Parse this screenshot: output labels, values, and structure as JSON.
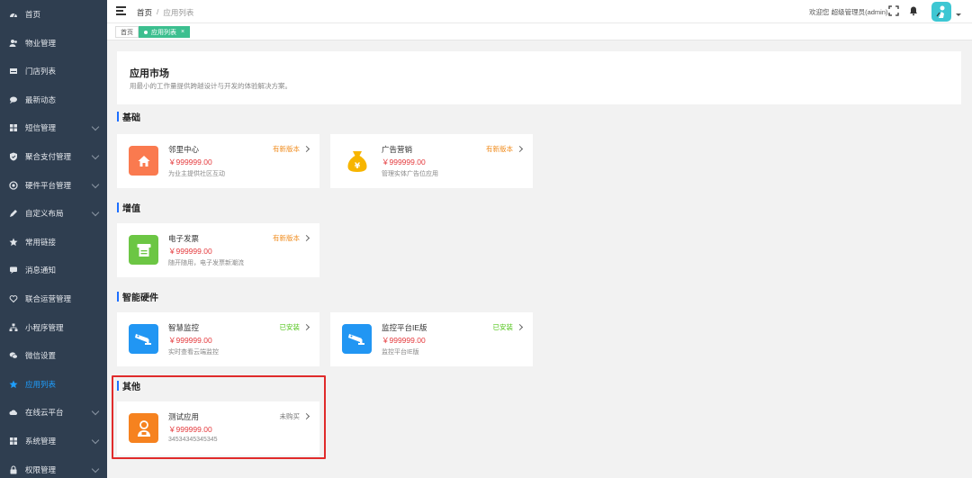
{
  "sidebar": {
    "items": [
      {
        "label": "首页",
        "icon": "dashboard-icon",
        "chevron": false,
        "active": false
      },
      {
        "label": "物业管理",
        "icon": "users-icon",
        "chevron": false,
        "active": false
      },
      {
        "label": "门店列表",
        "icon": "store-icon",
        "chevron": false,
        "active": false
      },
      {
        "label": "最新动态",
        "icon": "chat-icon",
        "chevron": false,
        "active": false
      },
      {
        "label": "短信管理",
        "icon": "grid-icon",
        "chevron": true,
        "active": false
      },
      {
        "label": "聚合支付管理",
        "icon": "shield-icon",
        "chevron": true,
        "active": false
      },
      {
        "label": "硬件平台管理",
        "icon": "target-icon",
        "chevron": true,
        "active": false
      },
      {
        "label": "自定义布局",
        "icon": "pencil-icon",
        "chevron": true,
        "active": false
      },
      {
        "label": "常用链接",
        "icon": "star-icon",
        "chevron": false,
        "active": false
      },
      {
        "label": "消息通知",
        "icon": "message-icon",
        "chevron": false,
        "active": false
      },
      {
        "label": "联合运营管理",
        "icon": "heart-icon",
        "chevron": false,
        "active": false
      },
      {
        "label": "小程序管理",
        "icon": "sitemap-icon",
        "chevron": false,
        "active": false
      },
      {
        "label": "微信设置",
        "icon": "wechat-icon",
        "chevron": false,
        "active": false
      },
      {
        "label": "应用列表",
        "icon": "star-icon",
        "chevron": false,
        "active": true
      },
      {
        "label": "在线云平台",
        "icon": "cloud-icon",
        "chevron": true,
        "active": false
      },
      {
        "label": "系统管理",
        "icon": "grid-icon",
        "chevron": true,
        "active": false
      },
      {
        "label": "权限管理",
        "icon": "lock-icon",
        "chevron": true,
        "active": false
      }
    ]
  },
  "header": {
    "breadcrumb_home": "首页",
    "breadcrumb_sep": "/",
    "breadcrumb_current": "应用列表",
    "welcome": "欢迎您 超级管理员(admin)"
  },
  "tabs": [
    {
      "label": "首页",
      "active": false
    },
    {
      "label": "应用列表",
      "active": true,
      "close": "×"
    }
  ],
  "intro": {
    "title": "应用市场",
    "subtitle": "用最小的工作量提供跨越设计与开发的体验解决方案。"
  },
  "sections": [
    {
      "title": "基础",
      "apps": [
        {
          "name": "邻里中心",
          "price": "￥999999.00",
          "desc": "为业主提供社区互动",
          "status": "有新版本",
          "status_type": "update",
          "icon": "home-icon",
          "color": "#fa7a4f"
        },
        {
          "name": "广告营销",
          "price": "￥999999.00",
          "desc": "管理实体广告位应用",
          "status": "有新版本",
          "status_type": "update",
          "icon": "money-bag-icon",
          "color": "#ffffff"
        }
      ]
    },
    {
      "title": "增值",
      "apps": [
        {
          "name": "电子发票",
          "price": "￥999999.00",
          "desc": "随开随用，电子发票新潮流",
          "status": "有新版本",
          "status_type": "update",
          "icon": "invoice-icon",
          "color": "#6cc644"
        }
      ]
    },
    {
      "title": "智能硬件",
      "apps": [
        {
          "name": "智慧监控",
          "price": "￥999999.00",
          "desc": "实时查看云端监控",
          "status": "已安装",
          "status_type": "installed",
          "icon": "camera-icon",
          "color": "#2196f3"
        },
        {
          "name": "监控平台IE版",
          "price": "￥999999.00",
          "desc": "监控平台IE版",
          "status": "已安装",
          "status_type": "installed",
          "icon": "camera-icon",
          "color": "#2196f3"
        }
      ]
    },
    {
      "title": "其他",
      "apps": [
        {
          "name": "测试应用",
          "price": "￥999999.00",
          "desc": "34534345345345",
          "status": "未购买",
          "status_type": "unbought",
          "icon": "person-icon",
          "color": "#f6821f"
        }
      ]
    }
  ],
  "colors": {
    "sidebar_bg": "#2f3e50",
    "active_blue": "#1e9fff",
    "tab_green": "#3cbf8f",
    "price_red": "#e4393c",
    "highlight_red": "#e02b2b"
  }
}
